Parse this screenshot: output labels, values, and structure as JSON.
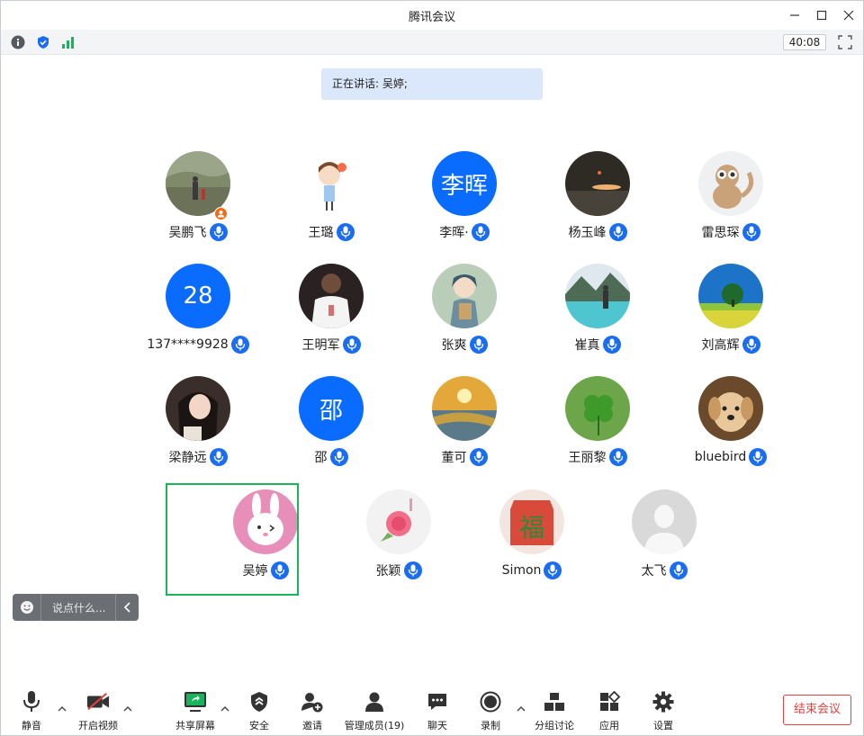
{
  "window": {
    "title": "腾讯会议"
  },
  "status": {
    "timer": "40:08"
  },
  "speaking": {
    "text": "正在讲话: 吴婷;"
  },
  "participants": [
    {
      "name": "吴鹏飞",
      "avatar": "photo-landscape",
      "host": true
    },
    {
      "name": "王璐",
      "avatar": "cartoon-girl"
    },
    {
      "name": "李晖·",
      "avatar": "text",
      "avatar_text": "李晖"
    },
    {
      "name": "杨玉峰",
      "avatar": "photo-dark"
    },
    {
      "name": "雷思琛",
      "avatar": "cartoon-monkey"
    },
    {
      "name": "137****9928",
      "avatar": "text",
      "avatar_text": "28"
    },
    {
      "name": "王明军",
      "avatar": "photo-basketball"
    },
    {
      "name": "张爽",
      "avatar": "anime"
    },
    {
      "name": "崔真",
      "avatar": "photo-lake"
    },
    {
      "name": "刘高辉",
      "avatar": "photo-tree"
    },
    {
      "name": "梁静远",
      "avatar": "photo-girl"
    },
    {
      "name": "邵",
      "avatar": "text",
      "avatar_text": "邵"
    },
    {
      "name": "董可",
      "avatar": "photo-sunset"
    },
    {
      "name": "王丽黎",
      "avatar": "photo-clover"
    },
    {
      "name": "bluebird",
      "avatar": "photo-puppy"
    },
    {
      "name": "吴婷",
      "avatar": "cartoon-rabbit",
      "active": true
    },
    {
      "name": "张颖",
      "avatar": "photo-rose"
    },
    {
      "name": "Simon",
      "avatar": "fu-character"
    },
    {
      "name": "太飞",
      "avatar": "default-person"
    }
  ],
  "chat": {
    "placeholder": "说点什么..."
  },
  "toolbar": {
    "mute": "静音",
    "video": "开启视频",
    "share": "共享屏幕",
    "security": "安全",
    "invite": "邀请",
    "members": "管理成员(19)",
    "chat": "聊天",
    "record": "录制",
    "breakout": "分组讨论",
    "apps": "应用",
    "settings": "设置",
    "end": "结束会议"
  },
  "colors": {
    "accent": "#0a6cff",
    "active_border": "#1ab55a",
    "end": "#e8403f",
    "speaking_bg": "#dbe8fb"
  }
}
